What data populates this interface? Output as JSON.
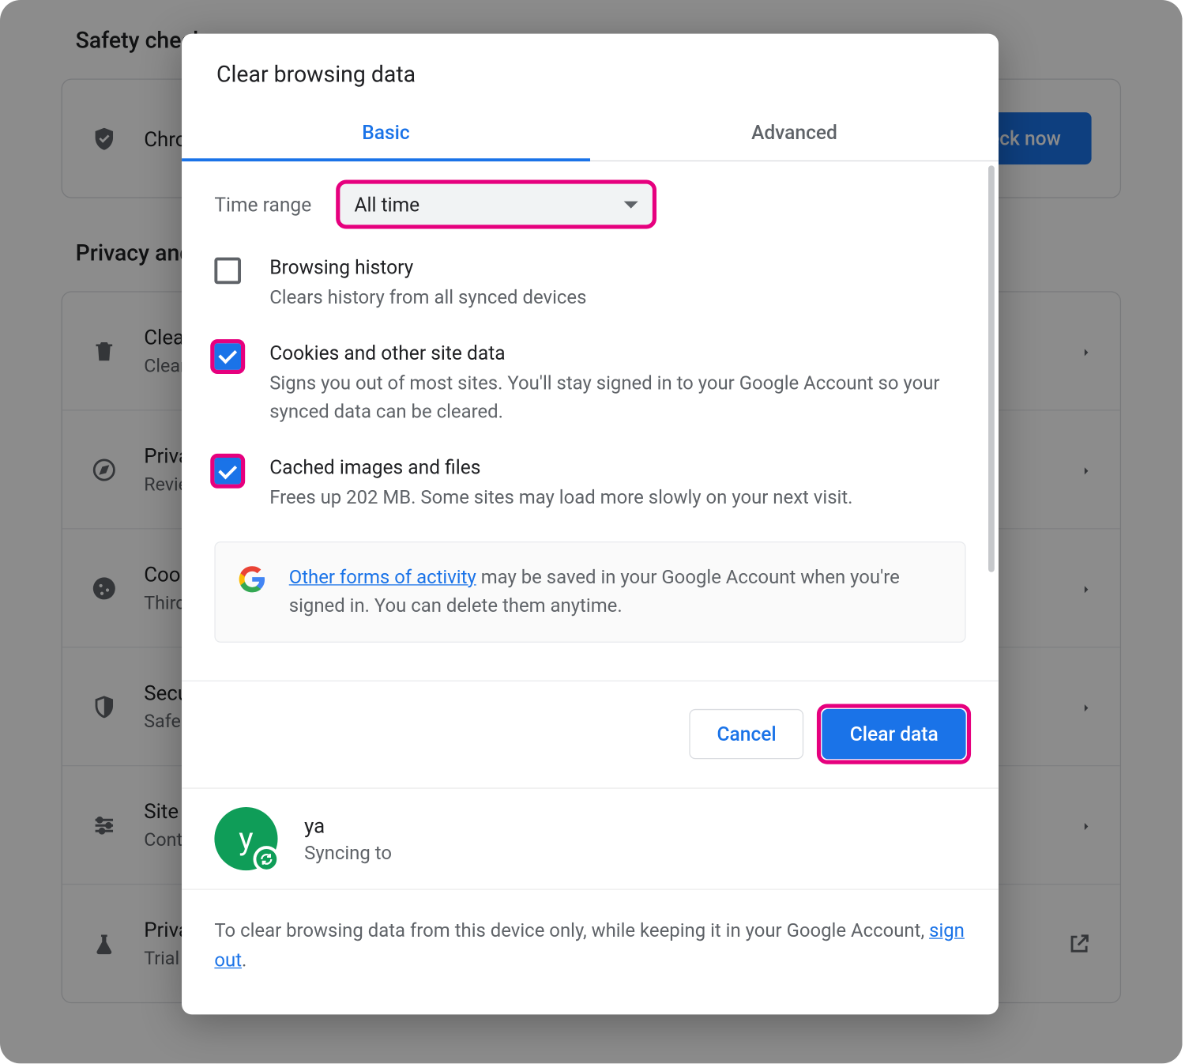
{
  "background": {
    "safety_title": "Safety check",
    "safety_row_text": "Chrome can help keep you safe",
    "check_now": "Check now",
    "privacy_title": "Privacy and security",
    "rows": [
      {
        "prim": "Clear browsing data",
        "sec": "Clear history, cookies, cache, and more"
      },
      {
        "prim": "Privacy Guide",
        "sec": "Review key privacy and security controls"
      },
      {
        "prim": "Cookies and other site data",
        "sec": "Third-party cookies are blocked"
      },
      {
        "prim": "Security",
        "sec": "Safe Browsing and other settings"
      },
      {
        "prim": "Site settings",
        "sec": "Controls what sites can use and show"
      },
      {
        "prim": "Privacy Sandbox",
        "sec": "Trial features are on"
      }
    ]
  },
  "dialog": {
    "title": "Clear browsing data",
    "tabs": {
      "basic": "Basic",
      "advanced": "Advanced"
    },
    "time_range_label": "Time range",
    "time_range_value": "All time",
    "items": [
      {
        "checked": false,
        "highlight": false,
        "title": "Browsing history",
        "desc": "Clears history from all synced devices"
      },
      {
        "checked": true,
        "highlight": true,
        "title": "Cookies and other site data",
        "desc": "Signs you out of most sites. You'll stay signed in to your Google Account so your synced data can be cleared."
      },
      {
        "checked": true,
        "highlight": true,
        "title": "Cached images and files",
        "desc": "Frees up 202 MB. Some sites may load more slowly on your next visit."
      }
    ],
    "info_link": "Other forms of activity",
    "info_rest": " may be saved in your Google Account when you're signed in. You can delete them anytime.",
    "cancel": "Cancel",
    "clear": "Clear data",
    "profile": {
      "initial": "y",
      "name": "ya",
      "status": "Syncing to"
    },
    "footer_pre": "To clear browsing data from this device only, while keeping it in your Google Account, ",
    "footer_link": "sign out",
    "footer_post": "."
  }
}
